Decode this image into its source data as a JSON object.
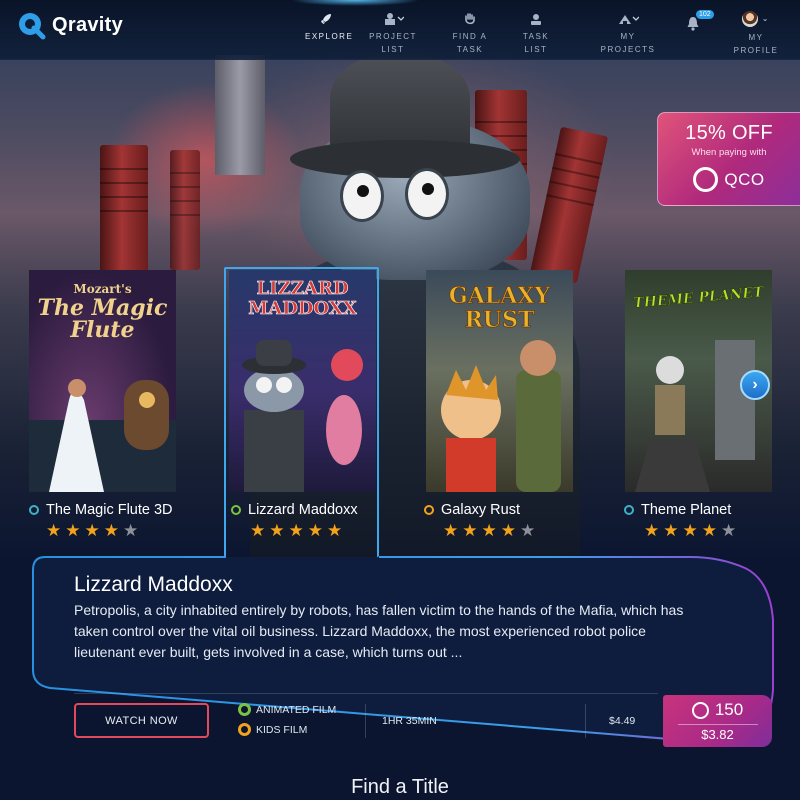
{
  "app": {
    "name": "Qravity"
  },
  "nav": {
    "items": [
      {
        "label": "EXPLORE",
        "icon": "rocket-icon",
        "active": true
      },
      {
        "label": "PROJECT LIST",
        "icon": "project-list-icon",
        "dropdown": true
      },
      {
        "label": "FIND A TASK",
        "icon": "hand-icon"
      },
      {
        "label": "TASK LIST",
        "icon": "task-list-icon"
      },
      {
        "label": "MY PROJECTS",
        "icon": "my-projects-icon",
        "dropdown": true
      }
    ],
    "notifications": {
      "count": "102",
      "icon": "bell-icon"
    },
    "profile": {
      "label": "MY PROFILE",
      "icon": "avatar"
    }
  },
  "promo": {
    "title": "15% OFF",
    "subtitle": "When paying with",
    "currency": "QCO"
  },
  "carousel": {
    "items": [
      {
        "title": "The Magic Flute 3D",
        "poster_text": [
          "Mozart's",
          "The Magic",
          "Flute"
        ],
        "rating": 4,
        "dot_color": "#3fb0c9"
      },
      {
        "title": "Lizzard Maddoxx",
        "poster_text": [
          "LIZZARD",
          "MADDOXX"
        ],
        "rating": 5,
        "dot_color": "#7cc242",
        "active": true
      },
      {
        "title": "Galaxy Rust",
        "poster_text": [
          "GALAXY",
          "RUST"
        ],
        "rating": 4,
        "dot_color": "#f2a21b"
      },
      {
        "title": "Theme Planet",
        "poster_text": [
          "THEME PLANET"
        ],
        "rating": 4,
        "dot_color": "#3fb0c9"
      }
    ],
    "max_rating": 5,
    "next_icon": "chevron-right-icon"
  },
  "detail": {
    "title": "Lizzard Maddoxx",
    "description": "Petropolis, a city inhabited entirely by robots, has fallen victim to the hands of the Mafia, which has taken control over the vital oil business. Lizzard Maddoxx, the most experienced robot police lieutenant ever built, gets involved in a case, which turns out ...",
    "watch_label": "WATCH NOW",
    "genres": [
      {
        "label": "ANIMATED FILM",
        "color": "#7cc242"
      },
      {
        "label": "KIDS FILM",
        "color": "#f2a21b"
      }
    ],
    "runtime": "1HR 35MIN",
    "price": "$4.49",
    "qco_price": "150",
    "usd_price": "$3.82"
  },
  "section": {
    "title": "Find a Title"
  },
  "colors": {
    "accent": "#3fa6f0",
    "brand_pink": "#c9337c",
    "star": "#f2a21b",
    "background": "#0b1530"
  }
}
